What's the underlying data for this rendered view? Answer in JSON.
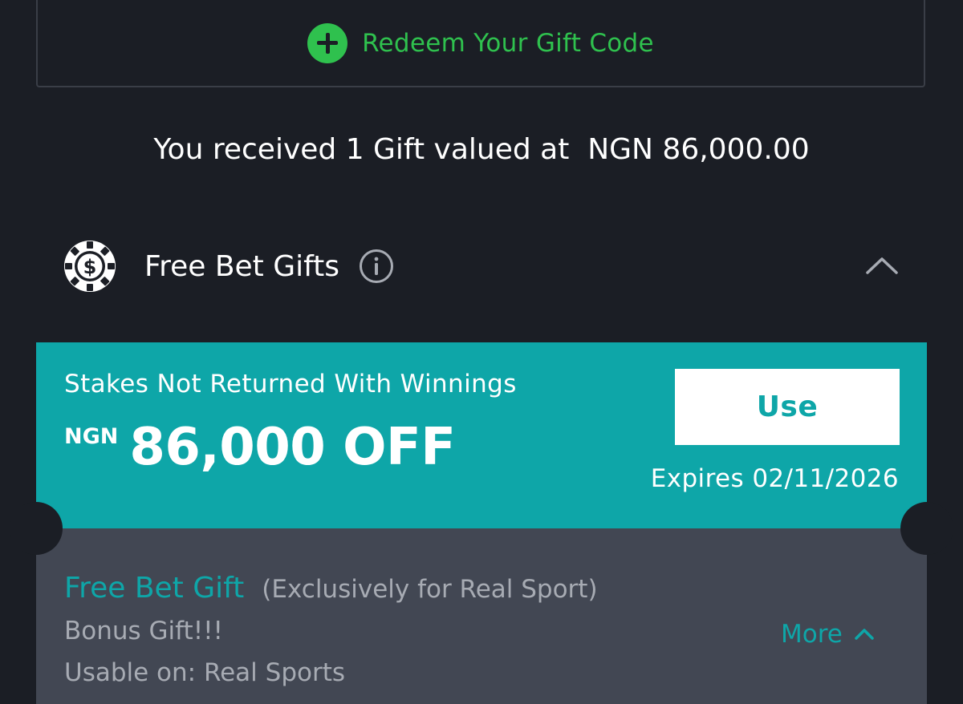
{
  "redeem": {
    "label": "Redeem Your Gift Code",
    "accent_color": "#2fc14e",
    "icon": "plus-circle-icon"
  },
  "summary": {
    "text": "You received 1 Gift valued at  NGN 86,000.00"
  },
  "section": {
    "title": "Free Bet Gifts",
    "icon": "casino-chip-dollar-icon",
    "info_icon": "info-icon",
    "collapse_icon": "chevron-up-icon"
  },
  "gift_card": {
    "subtitle": "Stakes Not Returned With Winnings",
    "currency": "NGN",
    "amount": "86,000 OFF",
    "use_label": "Use",
    "expires": "Expires 02/11/2026",
    "card_color": "#0ea6a8",
    "type_label": "Free Bet Gift",
    "scope": "(Exclusively for Real Sport)",
    "description": "Bonus Gift!!!",
    "usable_on": "Usable on: Real Sports",
    "more_label": "More"
  }
}
